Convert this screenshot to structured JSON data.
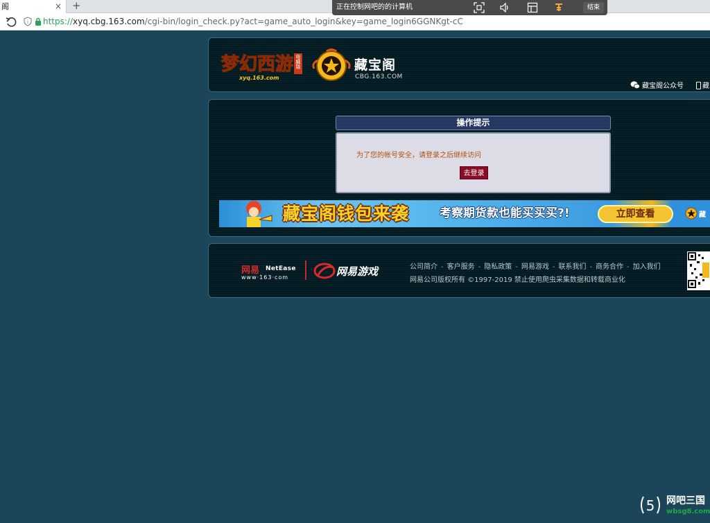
{
  "browser": {
    "tab_title": "阁",
    "tab_close": "×",
    "new_tab": "+",
    "url_protocol": "https://",
    "url_host": "xyq.cbg.163.com",
    "url_path": "/cgi-bin/login_check.py?act=game_auto_login&key=game_login6GGNKgt-cC"
  },
  "remote_bar": {
    "title": "正在控制网吧的的计算机",
    "end_label": "结束",
    "icons": [
      "screen-fit-icon",
      "volume-icon",
      "window-icon",
      "key-icon"
    ]
  },
  "header": {
    "game_logo_text": "梦幻西游",
    "game_logo_url": "xyq.163.com",
    "game_logo_badge": "电脑版",
    "cbg_name": "藏宝阁",
    "cbg_url": "CBG.163.COM",
    "wechat_label": "藏宝阁公众号",
    "mobile_label": "藏"
  },
  "dialog": {
    "title": "操作提示",
    "message": "为了您的帐号安全，请登录之后继续访问",
    "button": "去登录"
  },
  "banner": {
    "main_text": "藏宝阁钱包来袭",
    "sub_text": "考察期货款也能买买买?!",
    "button": "立即查看",
    "logo_text": "藏"
  },
  "footer": {
    "netease_cn": "网易",
    "netease_en": "NetEase",
    "netease_url": "www·163·com",
    "games_brand": "网易游戏",
    "links": [
      "公司简介",
      "客户服务",
      "隐私政策",
      "网易游戏",
      "联系我们",
      "商务合作",
      "加入我们"
    ],
    "separator": "-",
    "copyright": "网易公司版权所有 ©1997-2019  禁止使用爬虫采集数据和转载商业化"
  },
  "watermark": {
    "name": "网吧三国",
    "sub": "wbsg8.com"
  },
  "colors": {
    "page_bg": "#1b4558",
    "panel_bg": "#071f26",
    "dialog_head": "#2c3f6b",
    "login_button": "#8b0a26",
    "message_text": "#b2500e"
  }
}
